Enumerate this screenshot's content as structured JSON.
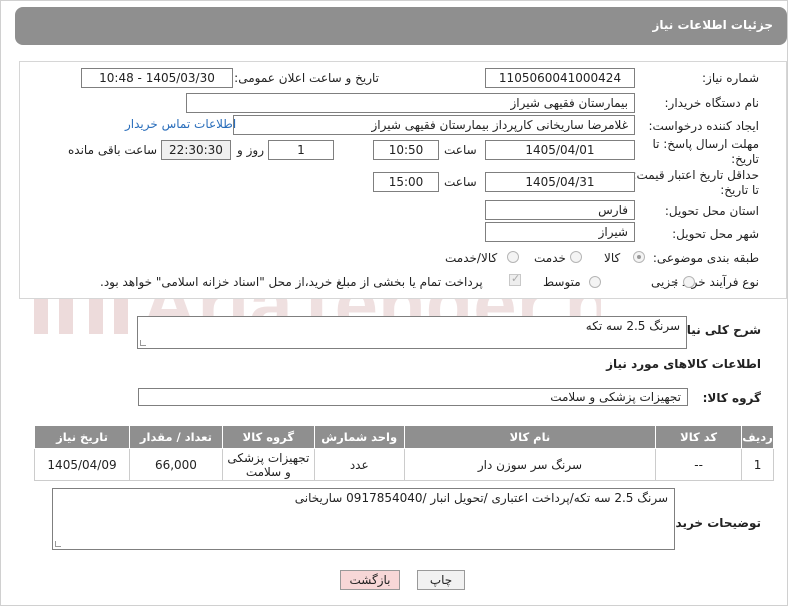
{
  "header": {
    "title": "جزئیات اطلاعات نیاز"
  },
  "form": {
    "need_number": {
      "label": "شماره نیاز:",
      "value": "1105060041000424"
    },
    "announce": {
      "label": "تاریخ و ساعت اعلان عمومی:",
      "value": "1405/03/30 - 10:48"
    },
    "buyer": {
      "label": "نام دستگاه خریدار:",
      "value": "بیمارستان فقیهی شیراز"
    },
    "creator": {
      "label": "ایجاد کننده درخواست:",
      "value": "غلامرضا ساریخانی کارپرداز بیمارستان فقیهی شیراز",
      "link": "اطلاعات تماس خریدار"
    },
    "deadline": {
      "label_line1": "مهلت ارسال پاسخ: تا",
      "label_line2": "تاریخ:",
      "date": "1405/04/01",
      "time_label": "ساعت",
      "time": "10:50",
      "days": "1",
      "days_label": "روز و",
      "remaining": "22:30:30",
      "remaining_label": "ساعت باقی مانده"
    },
    "price_validity": {
      "label_line1": "حداقل تاریخ اعتبار قیمت:",
      "label_line2": "تا تاریخ:",
      "date": "1405/04/31",
      "time_label": "ساعت",
      "time": "15:00"
    },
    "province": {
      "label": "استان محل تحویل:",
      "value": "فارس"
    },
    "city": {
      "label": "شهر محل تحویل:",
      "value": "شیراز"
    },
    "category": {
      "label": "طبقه بندی موضوعی:",
      "options": [
        "کالا",
        "خدمت",
        "کالا/خدمت"
      ]
    },
    "process": {
      "label": "نوع فرآیند خرید :",
      "options": [
        "جزیی",
        "متوسط"
      ],
      "payment_note": "پرداخت تمام یا بخشی از مبلغ خرید،از محل \"اسناد خزانه اسلامی\" خواهد بود."
    }
  },
  "need_desc": {
    "label": "شرح کلی نیاز:",
    "value": "سرنگ 2.5 سه تکه"
  },
  "goods_info": {
    "title": "اطلاعات کالاهای مورد نیاز"
  },
  "goods_group": {
    "label": "گروه کالا:",
    "value": "تجهیزات پزشکی و سلامت"
  },
  "table": {
    "headers": [
      "ردیف",
      "کد کالا",
      "نام کالا",
      "واحد شمارش",
      "گروه کالا",
      "تعداد / مقدار",
      "تاریخ نیاز"
    ],
    "rows": [
      {
        "row": "1",
        "code": "--",
        "name": "سرنگ سر سوزن دار",
        "unit": "عدد",
        "group": "تجهیزات پزشکی و سلامت",
        "qty": "66,000",
        "date": "1405/04/09"
      }
    ]
  },
  "buyer_notes": {
    "label": "توضیحات خریدار:",
    "value": "سرنگ 2.5 سه تکه/پرداخت اعتباری /تحویل انبار /0917854040 ساریخانی"
  },
  "buttons": {
    "print": "چاپ",
    "back": "بازگشت"
  },
  "watermark": {
    "text": "AriaTender.neT"
  },
  "colors": {
    "header_bg": "#8f8f8f",
    "link": "#2a6ebb",
    "back_button_bg": "#f7d7d7",
    "watermark": "#e6c9c9"
  }
}
